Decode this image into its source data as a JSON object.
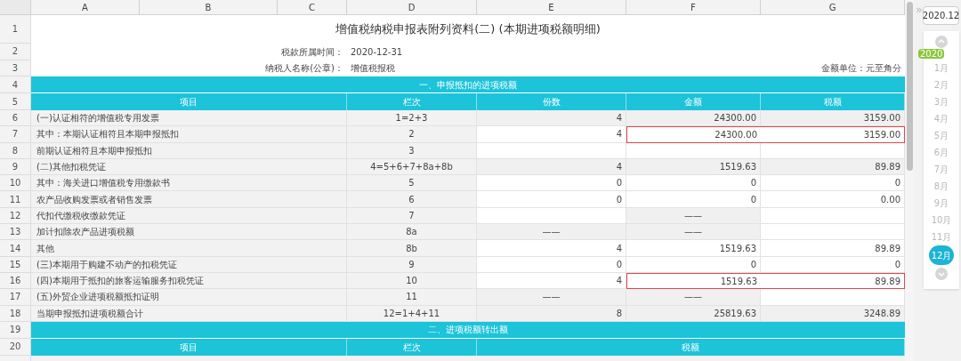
{
  "columns": [
    "A",
    "B",
    "C",
    "D",
    "E",
    "F",
    "G"
  ],
  "title_row": {
    "number": "1",
    "title": "增值税纳税申报表附列资料(二) (本期进项税额明细)"
  },
  "info_rows": [
    {
      "number": "2",
      "label": "税款所属时间：",
      "value": "2020-12-31"
    },
    {
      "number": "3",
      "label": "纳税人名称(公章)：",
      "value": "增值税报税",
      "note": "金额单位：元至角分"
    }
  ],
  "sections": [
    {
      "number": "4",
      "title": "一、申报抵扣的进项税额",
      "header": {
        "number": "5",
        "cells": [
          "项目",
          "栏次",
          "份数",
          "金额",
          "税额"
        ]
      },
      "rows": [
        {
          "number": "6",
          "item": "(一)认证相符的增值税专用发票",
          "line": "1=2+3",
          "flagged": false,
          "values": [
            {
              "text": "4",
              "editable": false
            },
            {
              "text": "24300.00",
              "editable": false
            },
            {
              "text": "3159.00",
              "editable": false
            }
          ]
        },
        {
          "number": "7",
          "item": "其中：本期认证相符且本期申报抵扣",
          "line": "2",
          "flagged": true,
          "values": [
            {
              "text": "4",
              "editable": true
            },
            {
              "text": "24300.00",
              "editable": true
            },
            {
              "text": "3159.00",
              "editable": true
            }
          ]
        },
        {
          "number": "8",
          "item": "前期认证相符且本期申报抵扣",
          "line": "3",
          "flagged": false,
          "values": [
            {
              "editable": true
            },
            {
              "editable": true
            },
            {
              "editable": true
            }
          ]
        },
        {
          "number": "9",
          "item": "(二)其他扣税凭证",
          "line": "4=5+6+7+8a+8b",
          "flagged": false,
          "values": [
            {
              "text": "4",
              "editable": false
            },
            {
              "text": "1519.63",
              "editable": false
            },
            {
              "text": "89.89",
              "editable": false
            }
          ]
        },
        {
          "number": "10",
          "item": "其中：海关进口增值税专用缴款书",
          "line": "5",
          "flagged": false,
          "values": [
            {
              "text": "0",
              "editable": true
            },
            {
              "text": "0",
              "editable": true
            },
            {
              "text": "0",
              "editable": true
            }
          ]
        },
        {
          "number": "11",
          "item": "农产品收购发票或者销售发票",
          "line": "6",
          "flagged": false,
          "values": [
            {
              "text": "0",
              "editable": true
            },
            {
              "text": "0",
              "editable": true
            },
            {
              "text": "0.00",
              "editable": true
            }
          ]
        },
        {
          "number": "12",
          "item": "代扣代缴税收缴款凭证",
          "line": "7",
          "flagged": false,
          "values": [
            {
              "editable": true
            },
            {
              "text": "——",
              "editable": false
            },
            {
              "editable": true
            }
          ]
        },
        {
          "number": "13",
          "item": "加计扣除农产品进项税额",
          "line": "8a",
          "flagged": false,
          "values": [
            {
              "text": "——",
              "editable": false
            },
            {
              "text": "——",
              "editable": false
            },
            {
              "editable": true
            }
          ]
        },
        {
          "number": "14",
          "item": "其他",
          "line": "8b",
          "flagged": false,
          "values": [
            {
              "text": "4",
              "editable": true
            },
            {
              "text": "1519.63",
              "editable": true
            },
            {
              "text": "89.89",
              "editable": true
            }
          ]
        },
        {
          "number": "15",
          "item": "(三)本期用于购建不动产的扣税凭证",
          "line": "9",
          "flagged": false,
          "values": [
            {
              "text": "0",
              "editable": true
            },
            {
              "text": "0",
              "editable": true
            },
            {
              "text": "0",
              "editable": true
            }
          ]
        },
        {
          "number": "16",
          "item": "(四)本期用于抵扣的旅客运输服务扣税凭证",
          "line": "10",
          "flagged": true,
          "values": [
            {
              "text": "4",
              "editable": true
            },
            {
              "text": "1519.63",
              "editable": true
            },
            {
              "text": "89.89",
              "editable": true
            }
          ]
        },
        {
          "number": "17",
          "item": "(五)外贸企业进项税额抵扣证明",
          "line": "11",
          "flagged": false,
          "values": [
            {
              "text": "——",
              "editable": false
            },
            {
              "text": "——",
              "editable": false
            },
            {
              "editable": true
            }
          ]
        },
        {
          "number": "18",
          "item": "当期申报抵扣进项税额合计",
          "line": "12=1+4+11",
          "flagged": false,
          "values": [
            {
              "text": "8",
              "editable": false
            },
            {
              "text": "25819.63",
              "editable": false
            },
            {
              "text": "3248.89",
              "editable": false
            }
          ]
        }
      ]
    },
    {
      "number": "19",
      "title": "二、进项税额转出额",
      "header": {
        "number": "20",
        "cells": [
          "项目",
          "栏次",
          "税额"
        ]
      }
    }
  ],
  "side_panel": {
    "expand": "»",
    "period": "2020.12",
    "year_badge": "2020",
    "months": [
      {
        "label": "1月",
        "selected": false
      },
      {
        "label": "2月",
        "selected": false
      },
      {
        "label": "3月",
        "selected": false
      },
      {
        "label": "4月",
        "selected": false
      },
      {
        "label": "5月",
        "selected": false
      },
      {
        "label": "6月",
        "selected": false
      },
      {
        "label": "7月",
        "selected": false
      },
      {
        "label": "8月",
        "selected": false
      },
      {
        "label": "9月",
        "selected": false
      },
      {
        "label": "10月",
        "selected": false
      },
      {
        "label": "11月",
        "selected": false
      },
      {
        "label": "12月",
        "selected": true
      }
    ]
  }
}
